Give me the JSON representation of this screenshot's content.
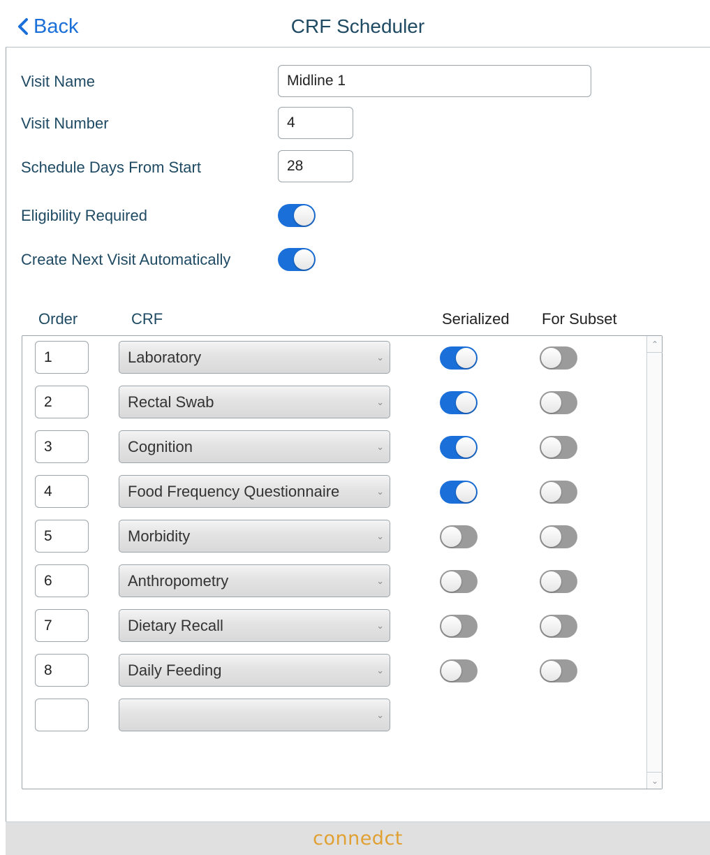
{
  "navbar": {
    "back_label": "Back",
    "title": "CRF Scheduler"
  },
  "form": {
    "visit_name_label": "Visit Name",
    "visit_name_value": "Midline 1",
    "visit_number_label": "Visit Number",
    "visit_number_value": "4",
    "schedule_days_label": "Schedule Days From Start",
    "schedule_days_value": "28",
    "eligibility_label": "Eligibility Required",
    "eligibility_on": true,
    "auto_next_label": "Create Next Visit Automatically",
    "auto_next_on": true
  },
  "table": {
    "headers": {
      "order": "Order",
      "crf": "CRF",
      "serialized": "Serialized",
      "for_subset": "For Subset"
    },
    "rows": [
      {
        "order": "1",
        "crf": "Laboratory",
        "serialized": true,
        "for_subset": false
      },
      {
        "order": "2",
        "crf": "Rectal Swab",
        "serialized": true,
        "for_subset": false
      },
      {
        "order": "3",
        "crf": "Cognition",
        "serialized": true,
        "for_subset": false
      },
      {
        "order": "4",
        "crf": "Food Frequency Questionnaire",
        "serialized": true,
        "for_subset": false
      },
      {
        "order": "5",
        "crf": "Morbidity",
        "serialized": false,
        "for_subset": false
      },
      {
        "order": "6",
        "crf": "Anthropometry",
        "serialized": false,
        "for_subset": false
      },
      {
        "order": "7",
        "crf": "Dietary Recall",
        "serialized": false,
        "for_subset": false
      },
      {
        "order": "8",
        "crf": "Daily Feeding",
        "serialized": false,
        "for_subset": false
      },
      {
        "order": "",
        "crf": "",
        "serialized": null,
        "for_subset": null
      }
    ]
  },
  "footer": {
    "logo_text": "connedct"
  },
  "colors": {
    "accent": "#1a6fd8",
    "label_text": "#1f4a63",
    "toggle_off": "#9b9b9b",
    "footer_bg": "#e0e0e0",
    "logo": "#e0a032"
  }
}
